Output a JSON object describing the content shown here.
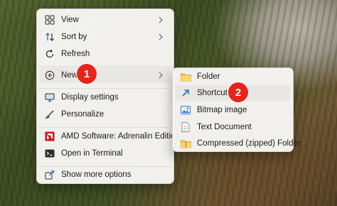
{
  "main_menu": {
    "items": [
      {
        "label": "View",
        "icon": "grid-view-icon",
        "has_submenu": true
      },
      {
        "label": "Sort by",
        "icon": "sort-icon",
        "has_submenu": true
      },
      {
        "label": "Refresh",
        "icon": "refresh-icon",
        "has_submenu": false
      },
      {
        "label": "New",
        "icon": "plus-circle-icon",
        "has_submenu": true,
        "highlighted": true
      },
      {
        "label": "Display settings",
        "icon": "display-icon",
        "has_submenu": false
      },
      {
        "label": "Personalize",
        "icon": "brush-icon",
        "has_submenu": false
      },
      {
        "label": "AMD Software: Adrenalin Edition",
        "icon": "amd-logo-icon",
        "has_submenu": false
      },
      {
        "label": "Open in Terminal",
        "icon": "terminal-icon",
        "has_submenu": false
      },
      {
        "label": "Show more options",
        "icon": "share-icon",
        "has_submenu": false
      }
    ]
  },
  "sub_menu": {
    "items": [
      {
        "label": "Folder",
        "icon": "folder-icon"
      },
      {
        "label": "Shortcut",
        "icon": "shortcut-icon",
        "highlighted": true
      },
      {
        "label": "Bitmap image",
        "icon": "bitmap-icon"
      },
      {
        "label": "Text Document",
        "icon": "text-document-icon"
      },
      {
        "label": "Compressed (zipped) Folder",
        "icon": "zip-folder-icon"
      }
    ]
  },
  "annotations": [
    {
      "label": "1",
      "target": "New"
    },
    {
      "label": "2",
      "target": "Shortcut"
    }
  ],
  "colors": {
    "badge": "#e5241c",
    "highlight": "#e9e7e3",
    "accent": "#0a63c4"
  }
}
